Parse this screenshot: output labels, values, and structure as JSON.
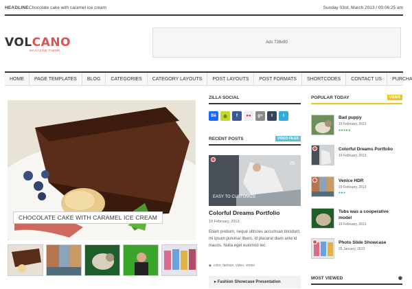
{
  "topbar": {
    "headline_tag": "HEADLINE",
    "headline_text": "Chocolate cake with caramel ice cream",
    "date": "Sunday 03rd, March 2013 / 00:06:25 am"
  },
  "brand": {
    "logo_part1": "VOL",
    "logo_part2": "CANO",
    "sub": "MAGAZINE THEME"
  },
  "ads": {
    "label": "Ads 728x90"
  },
  "nav": {
    "items": [
      "HOME",
      "PAGE TEMPLATES",
      "BLOG",
      "CATEGORIES",
      "CATEGORY LAYOUTS",
      "POST LAYOUTS",
      "POST FORMATS",
      "SHORTCODES",
      "CONTACT US",
      "PURCHASE"
    ]
  },
  "featured": {
    "caption": "CHOCOLATE CAKE WITH CARAMEL ICE CREAM"
  },
  "zilla_social": {
    "title": "ZILLA SOCIAL",
    "icons": [
      {
        "name": "behance-icon",
        "glyph": "Bē",
        "color": "#1769ff"
      },
      {
        "name": "dribbble-icon",
        "glyph": "◎",
        "color": "#c3d62b"
      },
      {
        "name": "facebook-icon",
        "glyph": "f",
        "color": "#3b5998"
      },
      {
        "name": "flickr-icon",
        "glyph": "●●",
        "color": "#eeeeee"
      },
      {
        "name": "googleplus-icon",
        "glyph": "g+",
        "color": "#8a8a8a"
      },
      {
        "name": "tumblr-icon",
        "glyph": "t",
        "color": "#35465c"
      },
      {
        "name": "twitter-icon",
        "glyph": "t",
        "color": "#33aadd"
      }
    ]
  },
  "recent_posts": {
    "title": "RECENT POSTS",
    "tag": "VIDEO FILES",
    "post_title": "Colorful Dreams Portfolio",
    "post_date": "19 February, 2013",
    "excerpt": "Etiam pretium, neque ultricies accumsan tincidunt, mi ipsum pulvinar libero, id placerat diam ante id mauris. Nulla eget euismod leo.",
    "tags": "color, fashion, video, vimeo",
    "next_link": "Fashion Showcase Presentation",
    "image_badge": "05",
    "image_text": "EASY TO CUSTOMIZE"
  },
  "popular_today": {
    "title": "POPULAR TODAY",
    "tag": "VIEWS",
    "items": [
      {
        "title": "Bad puppy",
        "date": "19 February, 2013",
        "stars": "●●●●●",
        "star_color": "#3cae48"
      },
      {
        "title": "Colorful Dreams Portfolio",
        "date": "19 February, 2013",
        "stars": "",
        "star_color": "#3cae48"
      },
      {
        "title": "Venice HDR",
        "date": "19 February, 2013",
        "stars": "●●●",
        "star_color": "#3aa0d8"
      },
      {
        "title": "Tubs was a cooperative model",
        "date": "19 February, 2013",
        "stars": "",
        "star_color": "#3cae48"
      },
      {
        "title": "Photo Slide Showcase",
        "date": "25 January, 2013",
        "stars": "",
        "star_color": "#3cae48"
      }
    ]
  },
  "most_viewed": {
    "title": "MOST VIEWED"
  },
  "colors": {
    "accent_red": "#d9534f",
    "tag_blue": "#5bc0de",
    "tag_yellow": "#f0c419"
  }
}
